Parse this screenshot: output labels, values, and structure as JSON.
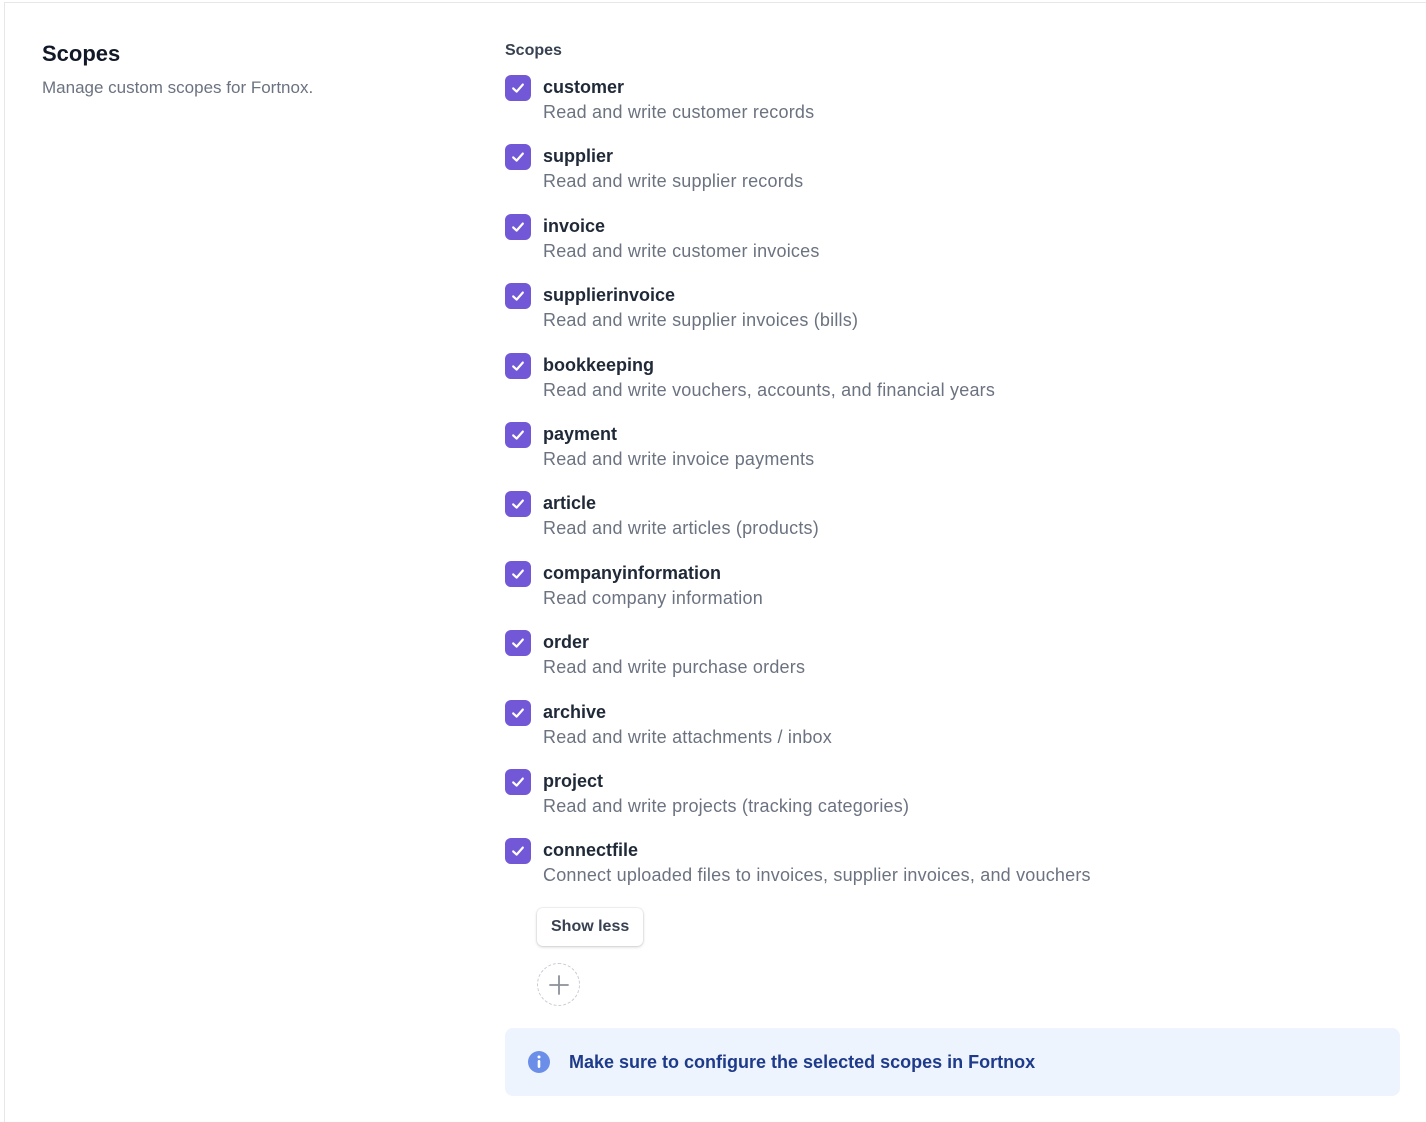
{
  "section": {
    "title": "Scopes",
    "description": "Manage custom scopes for Fortnox."
  },
  "field": {
    "label": "Scopes"
  },
  "scopes": [
    {
      "name": "customer",
      "description": "Read and write customer records",
      "checked": true
    },
    {
      "name": "supplier",
      "description": "Read and write supplier records",
      "checked": true
    },
    {
      "name": "invoice",
      "description": "Read and write customer invoices",
      "checked": true
    },
    {
      "name": "supplierinvoice",
      "description": "Read and write supplier invoices (bills)",
      "checked": true
    },
    {
      "name": "bookkeeping",
      "description": "Read and write vouchers, accounts, and financial years",
      "checked": true
    },
    {
      "name": "payment",
      "description": "Read and write invoice payments",
      "checked": true
    },
    {
      "name": "article",
      "description": "Read and write articles (products)",
      "checked": true
    },
    {
      "name": "companyinformation",
      "description": "Read company information",
      "checked": true
    },
    {
      "name": "order",
      "description": "Read and write purchase orders",
      "checked": true
    },
    {
      "name": "archive",
      "description": "Read and write attachments / inbox",
      "checked": true
    },
    {
      "name": "project",
      "description": "Read and write projects (tracking categories)",
      "checked": true
    },
    {
      "name": "connectfile",
      "description": "Connect uploaded files to invoices, supplier invoices, and vouchers",
      "checked": true
    }
  ],
  "actions": {
    "show_less_label": "Show less",
    "add_icon": "plus-icon"
  },
  "info": {
    "icon": "info-icon",
    "text": "Make sure to configure the selected scopes in Fortnox"
  },
  "colors": {
    "checkbox": "#7258d6",
    "info_bg": "#eef4fd",
    "info_text": "#1e3a8a",
    "info_icon": "#6b8ee8"
  }
}
